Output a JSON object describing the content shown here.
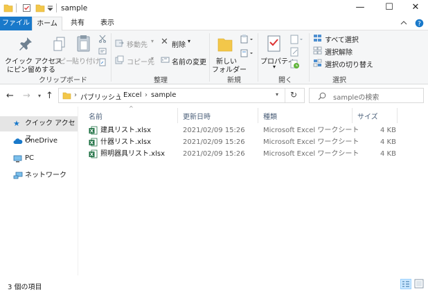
{
  "window": {
    "title": "sample"
  },
  "window_controls": {
    "minimize": "—",
    "maximize": "☐",
    "close": "✕"
  },
  "tabs": [
    {
      "label": "ファイル"
    },
    {
      "label": "ホーム"
    },
    {
      "label": "共有"
    },
    {
      "label": "表示"
    }
  ],
  "ribbon": {
    "quick_access_line1": "クイック アクセス",
    "quick_access_line2": "にピン留めする",
    "copy": "コピー",
    "paste": "貼り付け",
    "clipboard_group": "クリップボード",
    "move_to": "移動先",
    "delete": "削除",
    "copy_to": "コピー先",
    "rename": "名前の変更",
    "organize_group": "整理",
    "new_folder_line1": "新しい",
    "new_folder_line2": "フォルダー",
    "new_group": "新規",
    "properties": "プロパティ",
    "open_group": "開く",
    "select_all": "すべて選択",
    "select_none": "選択解除",
    "invert_selection": "選択の切り替え",
    "select_group": "選択"
  },
  "address": {
    "breadcrumb": [
      "パブリッシュ",
      "Excel",
      "sample"
    ],
    "search_placeholder": "sampleの検索"
  },
  "nav_pane": [
    {
      "label": "クイック アクセス"
    },
    {
      "label": "OneDrive"
    },
    {
      "label": "PC"
    },
    {
      "label": "ネットワーク"
    }
  ],
  "columns": {
    "name": "名前",
    "modified": "更新日時",
    "type": "種類",
    "size": "サイズ"
  },
  "files": [
    {
      "name": "建具リスト.xlsx",
      "modified": "2021/02/09 15:26",
      "type": "Microsoft Excel ワークシート",
      "size": "4 KB"
    },
    {
      "name": "什器リスト.xlsx",
      "modified": "2021/02/09 15:26",
      "type": "Microsoft Excel ワークシート",
      "size": "4 KB"
    },
    {
      "name": "照明器具リスト.xlsx",
      "modified": "2021/02/09 15:26",
      "type": "Microsoft Excel ワークシート",
      "size": "4 KB"
    }
  ],
  "status": {
    "item_count": "3 個の項目"
  },
  "colors": {
    "accent": "#1979ca",
    "folder": "#f3c74a",
    "excel": "#1f7244"
  }
}
